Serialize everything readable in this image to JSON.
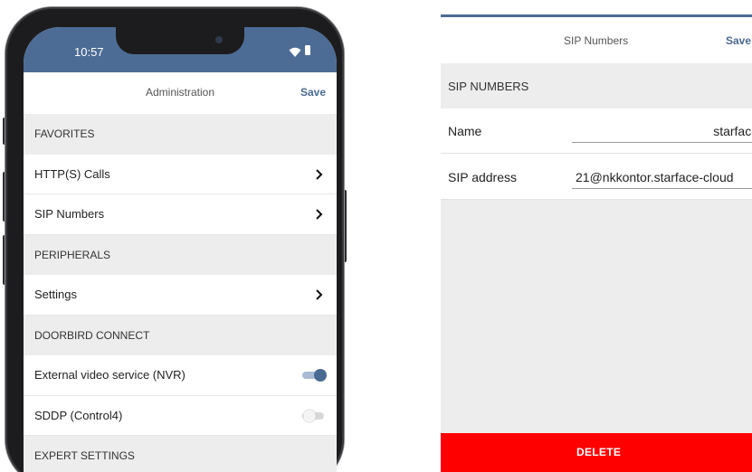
{
  "phone": {
    "status_time": "10:57",
    "nav": {
      "title": "Administration",
      "save_label": "Save"
    },
    "rows": [
      {
        "type": "section",
        "label": "FAVORITES"
      },
      {
        "type": "item",
        "label": "HTTP(S) Calls",
        "accessory": "chevron"
      },
      {
        "type": "item",
        "label": "SIP Numbers",
        "accessory": "chevron"
      },
      {
        "type": "section",
        "label": "PERIPHERALS"
      },
      {
        "type": "item",
        "label": "Settings",
        "accessory": "chevron"
      },
      {
        "type": "section",
        "label": "DOORBIRD CONNECT"
      },
      {
        "type": "item",
        "label": "External video service (NVR)",
        "accessory": "toggle",
        "toggle_on": true
      },
      {
        "type": "item",
        "label": "SDDP (Control4)",
        "accessory": "toggle",
        "toggle_on": false
      },
      {
        "type": "section",
        "label": "EXPERT SETTINGS"
      }
    ]
  },
  "detail": {
    "nav": {
      "title": "SIP Numbers",
      "save_label": "Save"
    },
    "section_label": "SIP NUMBERS",
    "fields": {
      "name": {
        "label": "Name",
        "value": "starface"
      },
      "sip_address": {
        "label": "SIP address",
        "value": "21@nkkontor.starface-cloud"
      }
    },
    "delete_label": "DELETE"
  },
  "colors": {
    "brand_blue": "#4d6c95",
    "accent_blue": "#4a6a93",
    "section_gray": "#ededed",
    "delete_red": "#ff0000"
  },
  "icons": {
    "chevron": "chevron-right-icon",
    "wifi": "wifi-icon",
    "battery": "battery-icon"
  }
}
